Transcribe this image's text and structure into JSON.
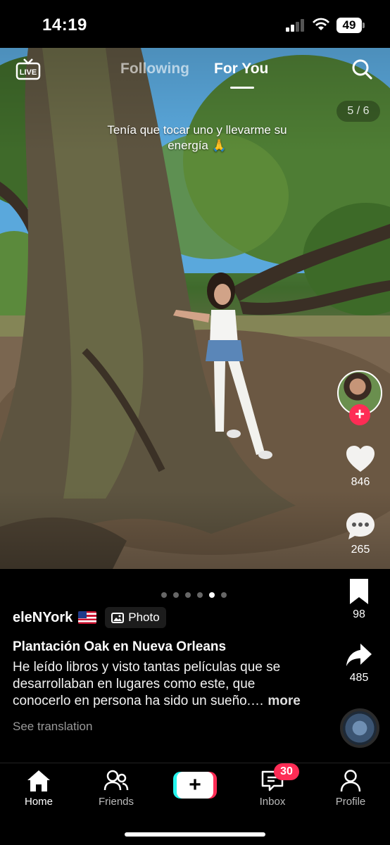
{
  "status_bar": {
    "time": "14:19",
    "battery": "49"
  },
  "top_nav": {
    "live_label": "LIVE",
    "tabs": [
      {
        "label": "Following",
        "active": false
      },
      {
        "label": "For You",
        "active": true
      }
    ]
  },
  "post": {
    "image_counter": "5 / 6",
    "caption": "Tenía que tocar uno y llevarme su energía 🙏",
    "carousel": {
      "total": 6,
      "active_index": 5
    },
    "username": "eleNYork",
    "type_chip": "Photo",
    "title": "Plantación Oak en Nueva Orleans",
    "description": "He leído libros y visto tantas películas que se desarrollaban en lugares como este, que conocerlo en persona ha sido un sueño.…",
    "more_label": "more",
    "translate_label": "See translation"
  },
  "actions": {
    "likes": "846",
    "comments": "265",
    "bookmarks": "98",
    "shares": "485"
  },
  "tab_bar": {
    "items": [
      {
        "label": "Home",
        "icon": "home-icon",
        "active": true
      },
      {
        "label": "Friends",
        "icon": "friends-icon",
        "active": false
      },
      {
        "label": "Inbox",
        "icon": "inbox-icon",
        "active": false
      },
      {
        "label": "Profile",
        "icon": "profile-icon",
        "active": false
      }
    ],
    "inbox_badge": "30"
  },
  "colors": {
    "accent": "#fe2c55",
    "cyan": "#25f4ee",
    "background": "#000000"
  }
}
